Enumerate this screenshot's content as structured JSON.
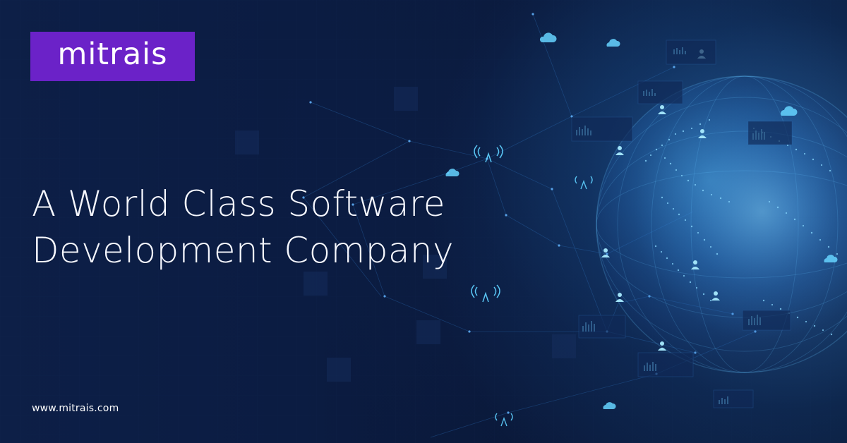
{
  "brand": {
    "logo_text": "mitrais",
    "logo_bg": "#6b22c8",
    "text_color": "#ffffff"
  },
  "headline": {
    "line1": "A World Class Software",
    "line2": "Development Company"
  },
  "footer": {
    "website": "www.mitrais.com"
  },
  "theme": {
    "background_start": "#0d1f47",
    "background_end": "#091631",
    "accent_blue": "#4aaaff",
    "globe_glow": "#2d7fd0"
  },
  "decor": {
    "icons": [
      "globe-icon",
      "cloud-icon",
      "user-icon",
      "bar-chart-icon",
      "signal-tower-icon"
    ]
  }
}
